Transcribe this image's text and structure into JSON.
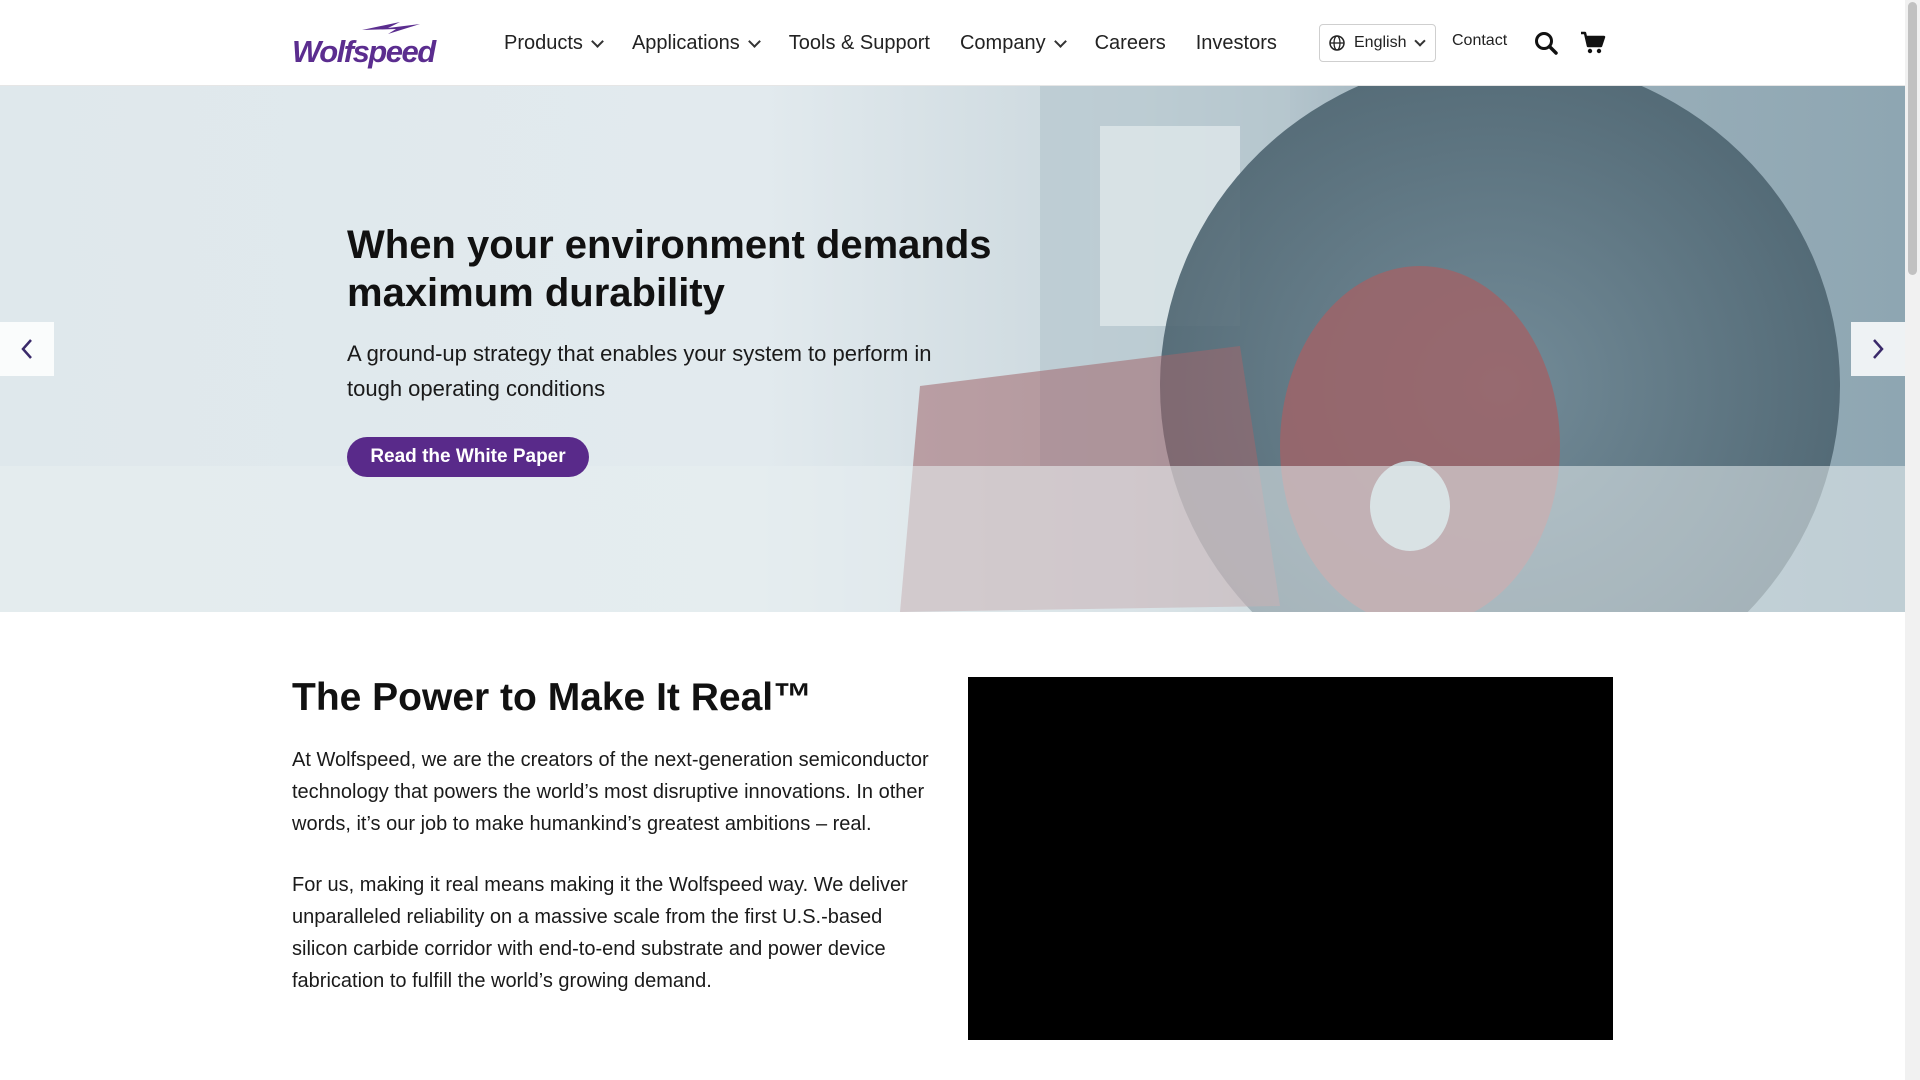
{
  "header": {
    "logo_text": "Wolfspeed",
    "nav": [
      {
        "label": "Products",
        "has_dropdown": true
      },
      {
        "label": "Applications",
        "has_dropdown": true
      },
      {
        "label": "Tools & Support",
        "has_dropdown": false
      },
      {
        "label": "Company",
        "has_dropdown": true
      },
      {
        "label": "Careers",
        "has_dropdown": false
      },
      {
        "label": "Investors",
        "has_dropdown": false
      }
    ],
    "language": "English",
    "contact": "Contact",
    "icons": [
      "globe-icon",
      "search-icon",
      "cart-icon"
    ]
  },
  "hero": {
    "title": "When your environment demands maximum durability",
    "subtitle": "A ground-up strategy that enables your system to perform in tough operating conditions",
    "cta": "Read the White Paper",
    "accent_color": "#592a8a"
  },
  "intro": {
    "title": "The Power to Make It Real™",
    "paragraph1": "At Wolfspeed, we are the creators of the next-generation semiconductor technology that powers the world’s most disruptive innovations. In other words, it’s our job to make humankind’s greatest ambitions – real.",
    "paragraph2": "For us, making it real means making it the Wolfspeed way. We deliver unparalleled reliability on a massive scale from the first U.S.-based silicon carbide corridor with end-to-end substrate and power device fabrication to fulfill the world’s growing demand."
  },
  "colors": {
    "brand": "#5b2d8f",
    "button": "#592a8a"
  }
}
